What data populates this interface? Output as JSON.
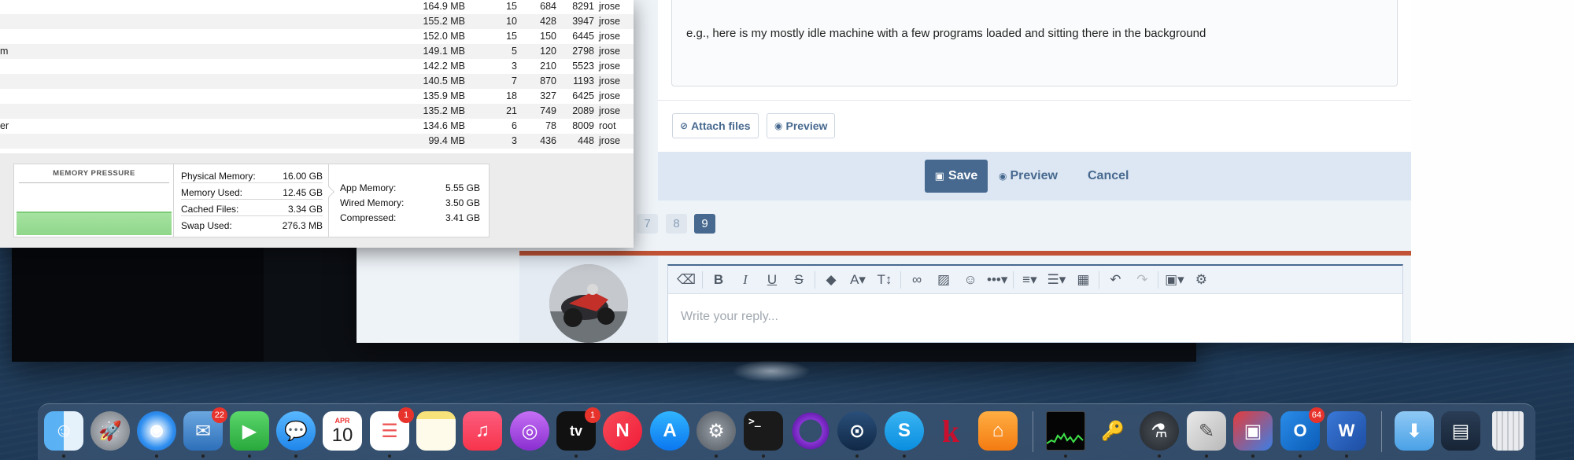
{
  "process_table": {
    "rows": [
      {
        "name": "",
        "memory": "164.9 MB",
        "threads": "15",
        "ports": "684",
        "pid": "8291",
        "user": "jrose"
      },
      {
        "name": "",
        "memory": "155.2 MB",
        "threads": "10",
        "ports": "428",
        "pid": "3947",
        "user": "jrose"
      },
      {
        "name": "",
        "memory": "152.0 MB",
        "threads": "15",
        "ports": "150",
        "pid": "6445",
        "user": "jrose"
      },
      {
        "name": "m",
        "memory": "149.1 MB",
        "threads": "5",
        "ports": "120",
        "pid": "2798",
        "user": "jrose"
      },
      {
        "name": "",
        "memory": "142.2 MB",
        "threads": "3",
        "ports": "210",
        "pid": "5523",
        "user": "jrose"
      },
      {
        "name": "",
        "memory": "140.5 MB",
        "threads": "7",
        "ports": "870",
        "pid": "1193",
        "user": "jrose"
      },
      {
        "name": "",
        "memory": "135.9 MB",
        "threads": "18",
        "ports": "327",
        "pid": "6425",
        "user": "jrose"
      },
      {
        "name": "",
        "memory": "135.2 MB",
        "threads": "21",
        "ports": "749",
        "pid": "2089",
        "user": "jrose"
      },
      {
        "name": "er",
        "memory": "134.6 MB",
        "threads": "6",
        "ports": "78",
        "pid": "8009",
        "user": "root"
      },
      {
        "name": "",
        "memory": "99.4 MB",
        "threads": "3",
        "ports": "436",
        "pid": "448",
        "user": "jrose"
      }
    ]
  },
  "memory_stats": {
    "pressure_title": "MEMORY PRESSURE",
    "physical": [
      {
        "label": "Physical Memory:",
        "value": "16.00 GB"
      },
      {
        "label": "Memory Used:",
        "value": "12.45 GB"
      },
      {
        "label": "Cached Files:",
        "value": "3.34 GB"
      },
      {
        "label": "Swap Used:",
        "value": "276.3 MB"
      }
    ],
    "app": [
      {
        "label": "App Memory:",
        "value": "5.55 GB"
      },
      {
        "label": "Wired Memory:",
        "value": "3.50 GB"
      },
      {
        "label": "Compressed:",
        "value": "3.41 GB"
      }
    ]
  },
  "forum": {
    "editor_text": "e.g., here is my mostly idle machine with a few programs loaded and sitting there in the background",
    "attach_label": "Attach files",
    "preview_label": "Preview",
    "save_label": "Save",
    "preview2_label": "Preview",
    "cancel_label": "Cancel",
    "pages": [
      "7",
      "8",
      "9"
    ],
    "current_page": "9",
    "reply_placeholder": "Write your reply..."
  },
  "dock": {
    "badges": {
      "mail": "22",
      "reminders": "1",
      "tv": "1",
      "outlook": "64"
    },
    "calendar_month": "APR",
    "calendar_day": "10",
    "tv_label": "tv",
    "kindle_label": "k",
    "outlook_label": "O",
    "word_label": "W",
    "terminal_prompt": ">_"
  },
  "colors": {
    "forum_accent": "#47698f",
    "rust_rule": "#c05336",
    "pressure_green": "#8fd68a"
  }
}
